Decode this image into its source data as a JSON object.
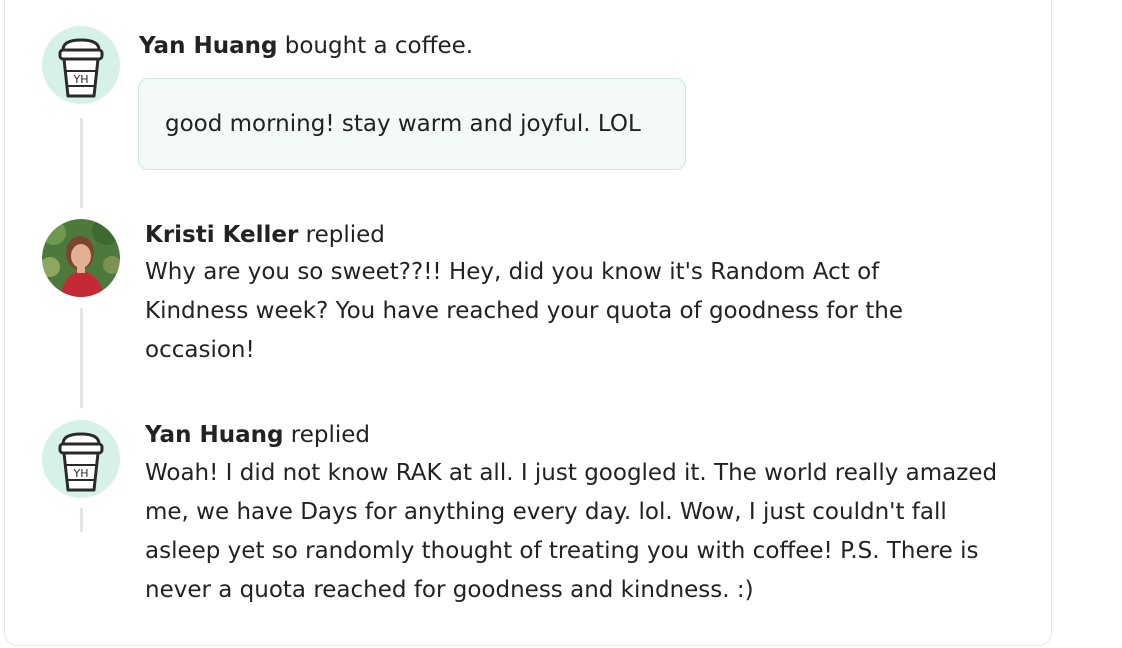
{
  "card": {
    "border_color": "#e6e6e6"
  },
  "avatar_cup_bg": "#d6f1e8",
  "post": {
    "author": "Yan Huang",
    "action": " bought a coffee.",
    "message": "good morning! stay warm and joyful. LOL",
    "avatar_icon": "coffee-cup-icon",
    "cup_initials": "YH"
  },
  "replies": [
    {
      "author": "Kristi Keller",
      "action": " replied",
      "text": "Why are you so sweet??!!  Hey, did you know it's Random Act of Kindness week?  You have reached your quota of goodness for the occasion!",
      "avatar_icon": "profile-photo"
    },
    {
      "author": "Yan Huang",
      "action": " replied",
      "text": "Woah! I did not know RAK at all. I just googled it.  The world really amazed me, we have Days for anything every day. lol.  Wow, I just couldn't fall asleep yet so randomly thought of treating you with coffee! P.S. There is never a quota reached for goodness and kindness. :)",
      "avatar_icon": "coffee-cup-icon",
      "cup_initials": "YH"
    }
  ]
}
